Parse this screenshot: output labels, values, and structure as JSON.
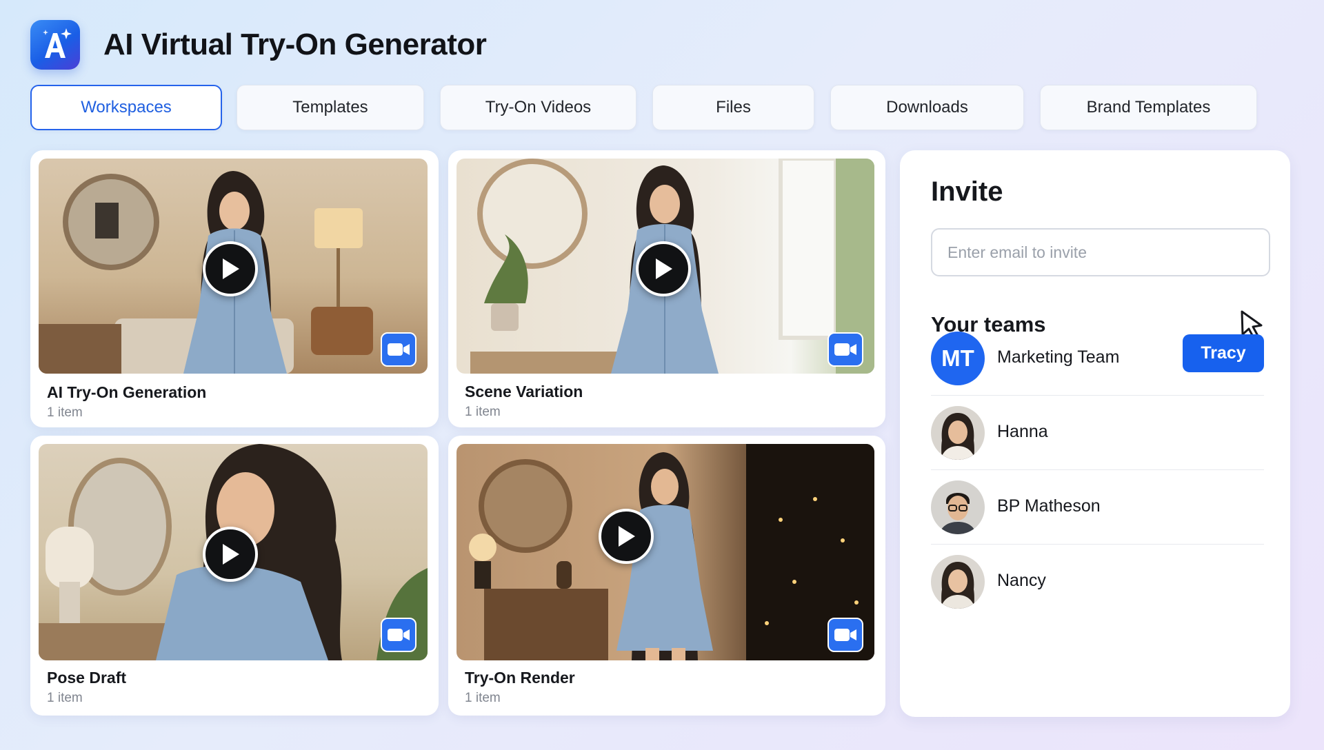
{
  "app": {
    "title": "AI Virtual Try-On Generator",
    "logo_icon": "sparkle-a-logo-icon",
    "brand_color": "#2563eb"
  },
  "tabs": [
    {
      "label": "Workspaces",
      "active": true
    },
    {
      "label": "Templates",
      "active": false
    },
    {
      "label": "Try-On Videos",
      "active": false
    },
    {
      "label": "Files",
      "active": false
    },
    {
      "label": "Downloads",
      "active": false
    },
    {
      "label": "Brand Templates",
      "active": false
    }
  ],
  "workspaces": [
    {
      "title": "AI Try-On Generation",
      "count": "1 item",
      "icons": [
        "play-icon",
        "video-camera-icon"
      ]
    },
    {
      "title": "Scene Variation",
      "count": "1 item",
      "icons": [
        "play-icon",
        "video-camera-icon"
      ]
    },
    {
      "title": "Pose Draft",
      "count": "1 item",
      "icons": [
        "play-icon",
        "video-camera-icon"
      ]
    },
    {
      "title": "Try-On Render",
      "count": "1 item",
      "icons": [
        "play-icon",
        "video-camera-icon"
      ]
    }
  ],
  "invite": {
    "title": "Invite",
    "email_placeholder": "Enter email to invite",
    "email_value": ""
  },
  "teams": {
    "title": "Your teams",
    "items": [
      {
        "name": "Marketing Team",
        "avatar_initials": "MT",
        "action_label": "Tracy",
        "avatar_color": "#1f66f0"
      },
      {
        "name": "Hanna",
        "avatar_icon": "user-avatar"
      },
      {
        "name": "BP Matheson",
        "avatar_icon": "user-avatar"
      },
      {
        "name": "Nancy",
        "avatar_icon": "user-avatar"
      }
    ]
  }
}
